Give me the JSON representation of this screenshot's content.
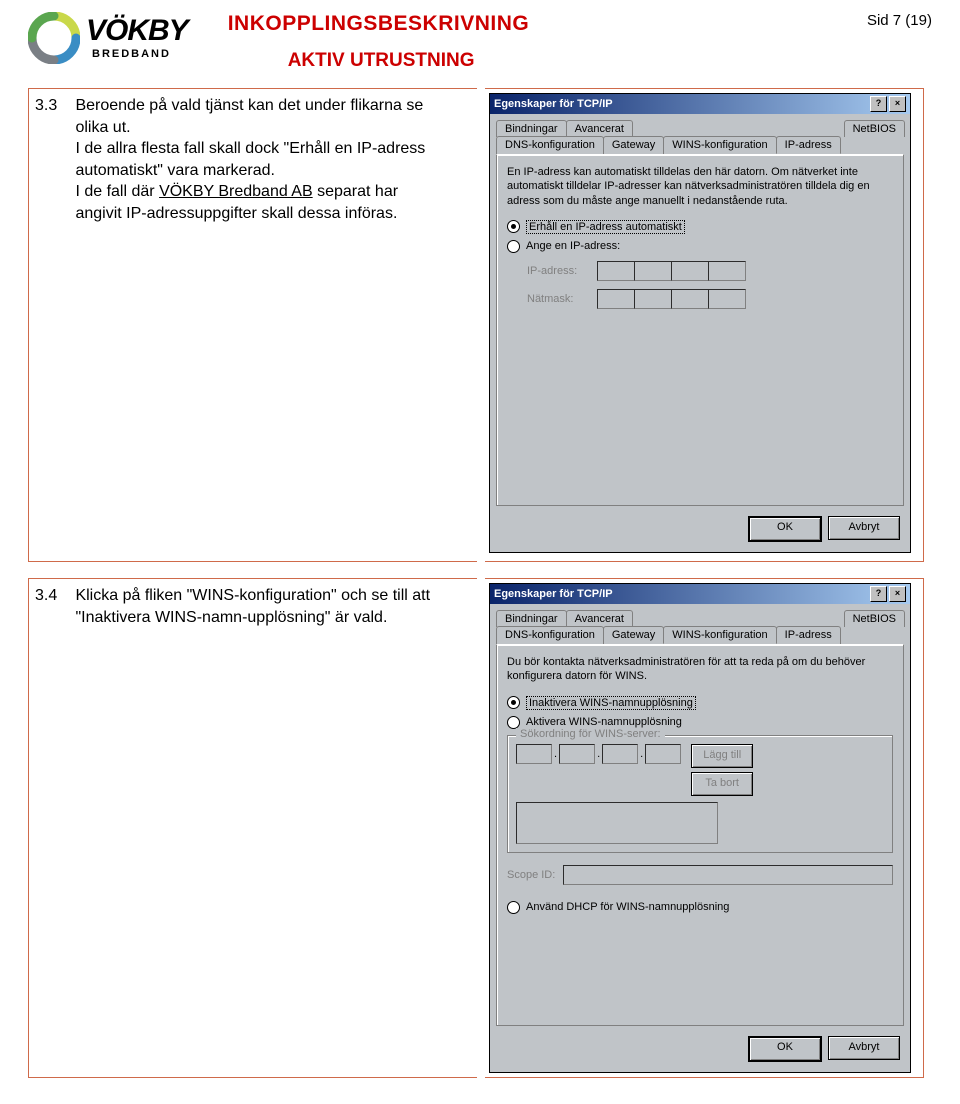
{
  "header": {
    "logo_name": "VÖKBY",
    "logo_subtitle": "BREDBAND",
    "doc_title": "INKOPPLINGSBESKRIVNING",
    "doc_subtitle": "AKTIV UTRUSTNING",
    "page_number": "Sid 7 (19)"
  },
  "steps": {
    "s33": {
      "num": "3.3",
      "text_a": "Beroende på vald tjänst kan det under flikarna se olika ut.",
      "text_b": "I de allra flesta fall skall dock \"Erhåll en IP-adress automatiskt\" vara markerad.",
      "text_c_pre": "I de fall där ",
      "text_c_link": "VÖKBY Bredband AB",
      "text_c_post": " separat har angivit IP-adressuppgifter skall dessa införas."
    },
    "s34": {
      "num": "3.4",
      "text": "Klicka på fliken \"WINS-konfiguration\" och se till att \"Inaktivera WINS-namn-upplösning\" är vald."
    }
  },
  "dlg1": {
    "title": "Egenskaper för TCP/IP",
    "help": "?",
    "close": "×",
    "tabs_row1": [
      "Bindningar",
      "Avancerat",
      "NetBIOS"
    ],
    "tabs_row2": [
      "DNS-konfiguration",
      "Gateway",
      "WINS-konfiguration",
      "IP-adress"
    ],
    "active_tab": "IP-adress",
    "desc": "En IP-adress kan automatiskt tilldelas den här datorn. Om nätverket inte automatiskt tilldelar IP-adresser kan nätverksadministratören tilldela dig en adress som du måste ange manuellt i nedanstående ruta.",
    "radio1": "Erhåll en IP-adress automatiskt",
    "radio2": "Ange en IP-adress:",
    "label_ip": "IP-adress:",
    "label_mask": "Nätmask:",
    "ok": "OK",
    "cancel": "Avbryt"
  },
  "dlg2": {
    "title": "Egenskaper för TCP/IP",
    "help": "?",
    "close": "×",
    "tabs_row1": [
      "Bindningar",
      "Avancerat",
      "NetBIOS"
    ],
    "tabs_row2": [
      "DNS-konfiguration",
      "Gateway",
      "WINS-konfiguration",
      "IP-adress"
    ],
    "active_tab": "WINS-konfiguration",
    "desc": "Du bör kontakta nätverksadministratören för att ta reda på om du behöver konfigurera datorn för WINS.",
    "radio1": "Inaktivera WINS-namnupplösning",
    "radio2": "Aktivera WINS-namnupplösning",
    "group_title": "Sökordning för WINS-server:",
    "btn_add": "Lägg till",
    "btn_remove": "Ta bort",
    "scope_label": "Scope ID:",
    "radio3": "Använd DHCP för WINS-namnupplösning",
    "ok": "OK",
    "cancel": "Avbryt"
  }
}
